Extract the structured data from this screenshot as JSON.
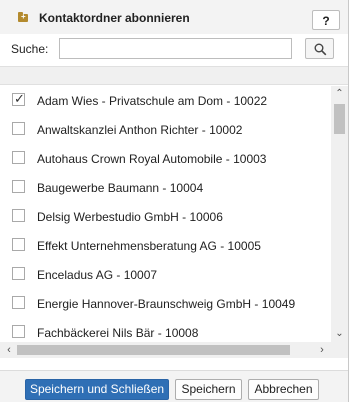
{
  "dialog": {
    "title": "Kontaktordner abonnieren",
    "help_label": "?"
  },
  "search": {
    "label": "Suche:",
    "value": "",
    "placeholder": ""
  },
  "list": {
    "items": [
      {
        "label": "Adam Wies - Privatschule am Dom - 10022",
        "checked": true
      },
      {
        "label": "Anwaltskanzlei Anthon Richter - 10002",
        "checked": false
      },
      {
        "label": "Autohaus Crown Royal Automobile - 10003",
        "checked": false
      },
      {
        "label": "Baugewerbe Baumann - 10004",
        "checked": false
      },
      {
        "label": "Delsig Werbestudio GmbH - 10006",
        "checked": false
      },
      {
        "label": "Effekt Unternehmensberatung AG - 10005",
        "checked": false
      },
      {
        "label": "Enceladus AG - 10007",
        "checked": false
      },
      {
        "label": "Energie Hannover-Braunschweig GmbH - 10049",
        "checked": false
      },
      {
        "label": "Fachbäckerei Nils Bär - 10008",
        "checked": false
      }
    ]
  },
  "footer": {
    "save_close_label": "Speichern und Schließen",
    "save_label": "Speichern",
    "cancel_label": "Abbrechen"
  },
  "colors": {
    "primary_button": "#2f6fb5",
    "folder_icon": "#b38a2e"
  },
  "icons": {
    "title": "folder-add-icon",
    "search": "search-icon",
    "check": "checkmark-icon"
  }
}
